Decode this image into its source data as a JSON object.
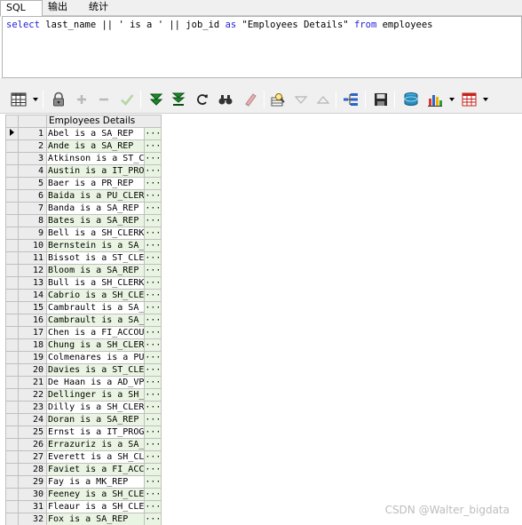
{
  "tabs": [
    {
      "label": "SQL"
    },
    {
      "label": "输出"
    },
    {
      "label": "统计"
    }
  ],
  "editor": {
    "sql_parts": [
      {
        "t": "select",
        "kw": true
      },
      {
        "t": " last_name || ' is a ' || job_id ",
        "kw": false
      },
      {
        "t": "as",
        "kw": true
      },
      {
        "t": " \"Employees Details\" ",
        "kw": false
      },
      {
        "t": "from",
        "kw": true
      },
      {
        "t": " employees",
        "kw": false
      }
    ]
  },
  "toolbar": {
    "icons": [
      "grid-view-icon",
      "lock-icon",
      "add-icon",
      "delete-icon",
      "commit-check-icon",
      "fetch-next-icon",
      "fetch-all-icon",
      "refresh-icon",
      "find-icon",
      "clear-icon",
      "query-by-example-icon",
      "sort-down-icon",
      "sort-up-icon",
      "explain-plan-icon",
      "save-icon",
      "export-db-icon",
      "chart-icon",
      "table-export-icon"
    ]
  },
  "grid": {
    "column_header": "Employees Details",
    "cell_button": "···",
    "rows": [
      {
        "n": "1",
        "v": "Abel is a SA_REP"
      },
      {
        "n": "2",
        "v": "Ande is a SA_REP"
      },
      {
        "n": "3",
        "v": "Atkinson is a ST_C"
      },
      {
        "n": "4",
        "v": "Austin is a IT_PRO"
      },
      {
        "n": "5",
        "v": "Baer is a PR_REP"
      },
      {
        "n": "6",
        "v": "Baida is a PU_CLER"
      },
      {
        "n": "7",
        "v": "Banda is a SA_REP"
      },
      {
        "n": "8",
        "v": "Bates is a SA_REP"
      },
      {
        "n": "9",
        "v": "Bell is a SH_CLERK"
      },
      {
        "n": "10",
        "v": "Bernstein is a SA_"
      },
      {
        "n": "11",
        "v": "Bissot is a ST_CLE"
      },
      {
        "n": "12",
        "v": "Bloom is a SA_REP"
      },
      {
        "n": "13",
        "v": "Bull is a SH_CLERK"
      },
      {
        "n": "14",
        "v": "Cabrio is a SH_CLE"
      },
      {
        "n": "15",
        "v": "Cambrault is a SA_"
      },
      {
        "n": "16",
        "v": "Cambrault is a SA_"
      },
      {
        "n": "17",
        "v": "Chen is a FI_ACCOU"
      },
      {
        "n": "18",
        "v": "Chung is a SH_CLER"
      },
      {
        "n": "19",
        "v": "Colmenares is a PU"
      },
      {
        "n": "20",
        "v": "Davies is a ST_CLE"
      },
      {
        "n": "21",
        "v": "De Haan is a AD_VP"
      },
      {
        "n": "22",
        "v": "Dellinger is a SH_"
      },
      {
        "n": "23",
        "v": "Dilly is a SH_CLER"
      },
      {
        "n": "24",
        "v": "Doran is a SA_REP"
      },
      {
        "n": "25",
        "v": "Ernst is a IT_PROG"
      },
      {
        "n": "26",
        "v": "Errazuriz is a SA_"
      },
      {
        "n": "27",
        "v": "Everett is a SH_CL"
      },
      {
        "n": "28",
        "v": "Faviet is a FI_ACC"
      },
      {
        "n": "29",
        "v": "Fay is a MK_REP"
      },
      {
        "n": "30",
        "v": "Feeney is a SH_CLE"
      },
      {
        "n": "31",
        "v": "Fleaur is a SH_CLE"
      },
      {
        "n": "32",
        "v": "Fox is a SA_REP"
      }
    ]
  },
  "watermark": "CSDN @Walter_bigdata"
}
